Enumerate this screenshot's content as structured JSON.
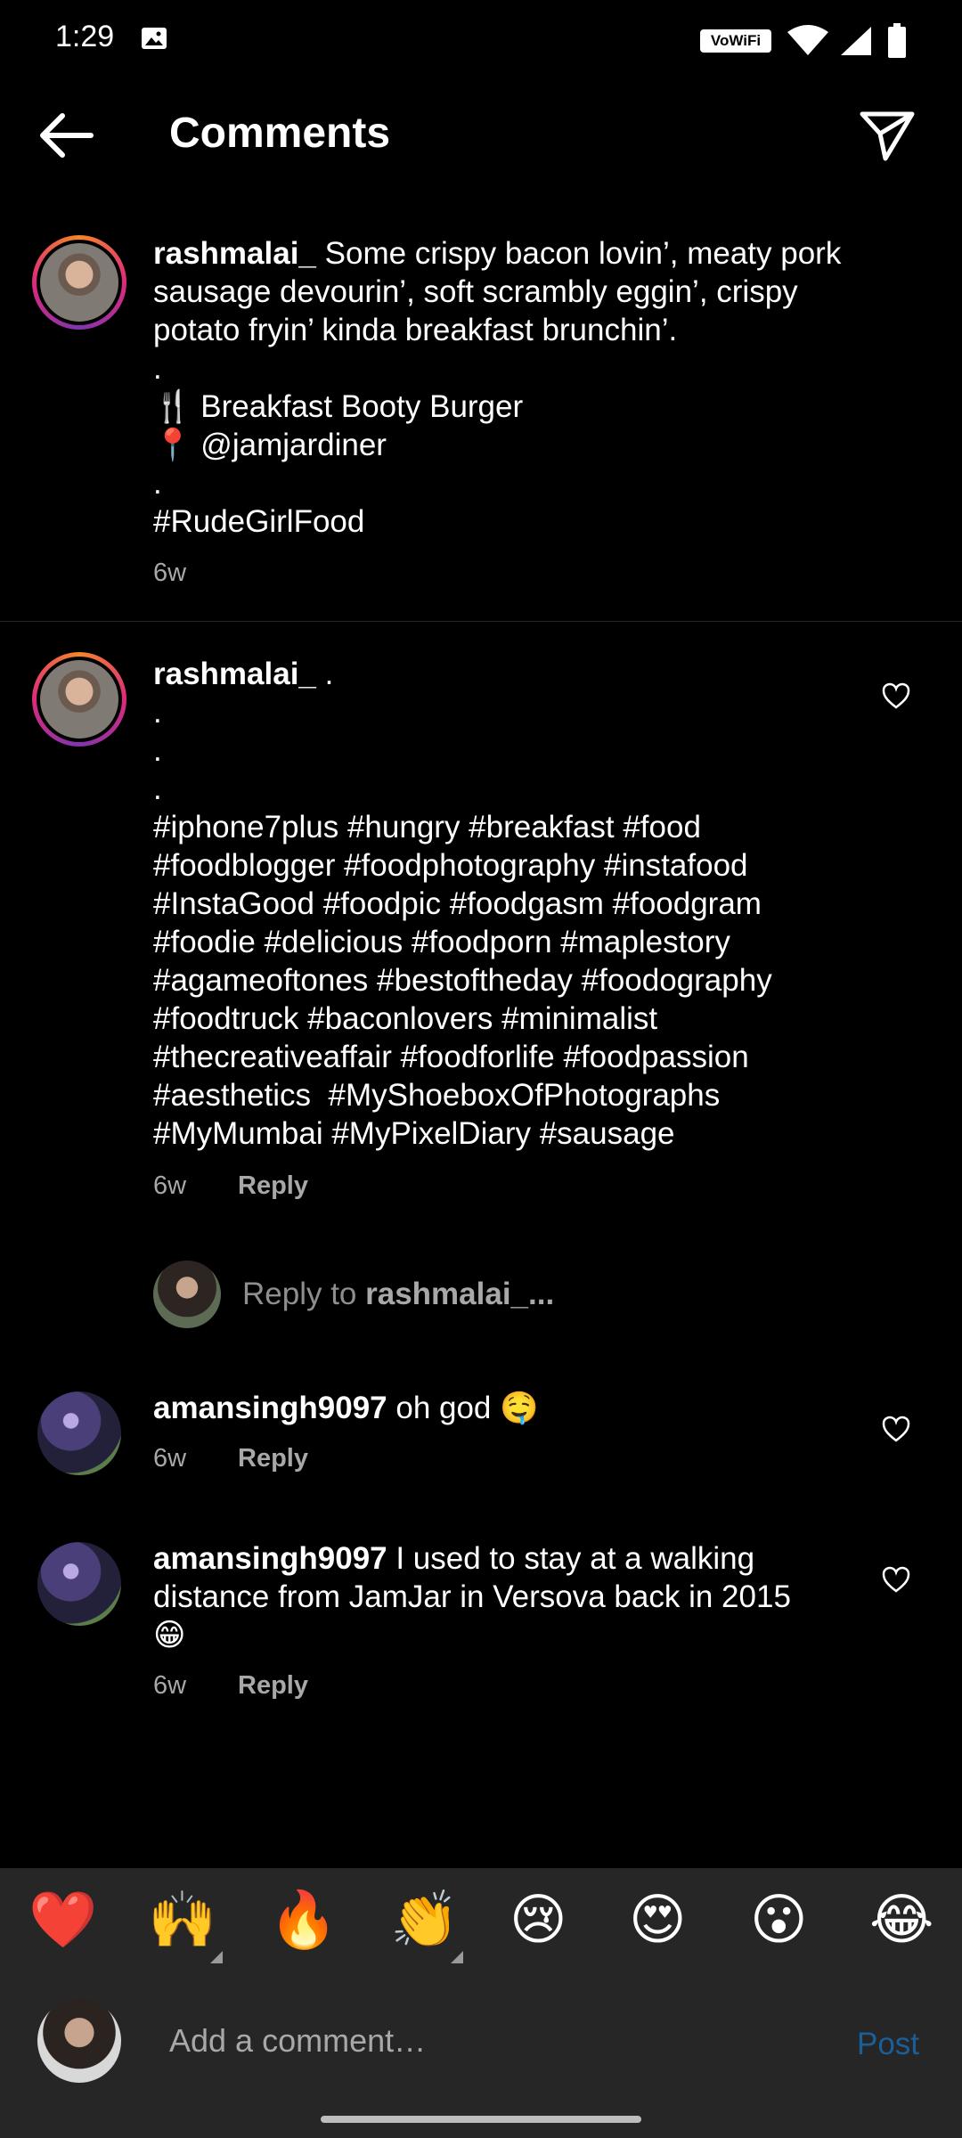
{
  "status_bar": {
    "time": "1:29",
    "wifi_label": "VoWiFi"
  },
  "header": {
    "title": "Comments"
  },
  "caption": {
    "username": "rashmalai_",
    "text": " Some crispy bacon lovin’, meaty pork\nsausage devourin’, soft scrambly eggin’, crispy\npotato fryin’ kinda breakfast brunchin’.\n.\n🍴 Breakfast Booty Burger\n📍 @jamjardiner\n.\n#RudeGirlFood",
    "time": "6w"
  },
  "comments": [
    {
      "username": "rashmalai_",
      "text": " .\n.\n.\n.\n#iphone7plus #hungry #breakfast #food\n#foodblogger #foodphotography #instafood\n#InstaGood #foodpic #foodgasm #foodgram\n#foodie #delicious #foodporn #maplestory\n#agameoftones #bestoftheday #foodography\n#foodtruck #baconlovers #minimalist\n#thecreativeaffair #foodforlife #foodpassion\n#aesthetics  #MyShoeboxOfPhotographs\n#MyMumbai #MyPixelDiary #sausage",
      "time": "6w",
      "reply_label": "Reply"
    },
    {
      "username": "amansingh9097",
      "text": " oh god 🤤",
      "time": "6w",
      "reply_label": "Reply"
    },
    {
      "username": "amansingh9097",
      "text": " I used to stay at a walking\ndistance from JamJar in Versova back in 2015\n😁",
      "time": "6w",
      "reply_label": "Reply"
    }
  ],
  "reply_prompt": {
    "prefix": "Reply to ",
    "target": "rashmalai_..."
  },
  "emoji_bar": [
    "❤️",
    "🙌",
    "🔥",
    "👏",
    "😢",
    "😍",
    "😮",
    "😂"
  ],
  "comment_input": {
    "placeholder": "Add a comment…",
    "post_label": "Post"
  }
}
